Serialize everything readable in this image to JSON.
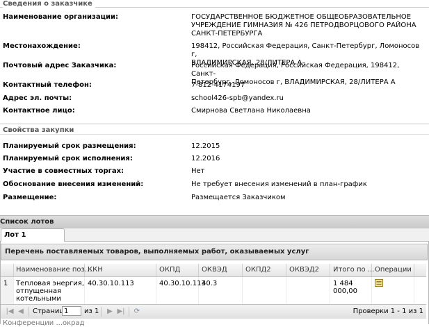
{
  "customer": {
    "legend": "Сведения о заказчике",
    "fields": [
      {
        "label": "Наименование организации:",
        "value": "ГОСУДАРСТВЕННОЕ БЮДЖЕТНОЕ ОБЩЕОБРАЗОВАТЕЛЬНОЕ\nУЧРЕЖДЕНИЕ ГИМНАЗИЯ № 426 ПЕТРОДВОРЦОВОГО РАЙОНА\nСАНКТ-ПЕТЕРБУРГА"
      },
      {
        "label": "Местонахождение:",
        "value": "198412, Российская Федерация, Санкт-Петербург, Ломоносов г,\nВЛАДИМИРСКАЯ, 28/ЛИТЕРА А"
      },
      {
        "label": "Почтовый адрес Заказчика:",
        "value": "Российская Федерация, Российская Федерация, 198412, Санкт-\nПетербург, Ломоносов г, ВЛАДИМИРСКАЯ, 28/ЛИТЕРА А"
      },
      {
        "label": "Контактный телефон:",
        "value": "7-812-4174197"
      },
      {
        "label": "Адрес эл. почты:",
        "value": "school426-spb@yandex.ru"
      },
      {
        "label": "Контактное лицо:",
        "value": "Смирнова Светлана Николаевна"
      }
    ]
  },
  "purchase": {
    "legend": "Свойства закупки",
    "fields": [
      {
        "label": "Планируемый срок размещения:",
        "value": "12.2015"
      },
      {
        "label": "Планируемый срок исполнения:",
        "value": "12.2016"
      },
      {
        "label": "Участие в совместных торгах:",
        "value": "Нет"
      },
      {
        "label": "Обоснование внесения изменений:",
        "value": "Не требует внесения изменений в план-график"
      },
      {
        "label": "Размещение:",
        "value": "Размещается Заказчиком"
      }
    ]
  },
  "lots": {
    "panel_title": "Список лотов",
    "tab_label": "Лот 1",
    "subheader": "Перечень поставляемых товаров, выполняемых работ, оказываемых услуг",
    "columns": [
      "Наименование поз...",
      "ККН",
      "ОКПД",
      "ОКВЭД",
      "ОКПД2",
      "ОКВЭД2",
      "Итого по ...",
      "Операции"
    ],
    "rows": [
      {
        "num": "1",
        "name": "Тепловая энергия,\nотпущенная\nкотельными",
        "kkn": "40.30.10.113",
        "okpd": "40.30.10.113",
        "okved": "40.3",
        "okpd2": "",
        "okved2": "",
        "total": "1 484\n000,00",
        "op_icon": "document-icon"
      }
    ],
    "pager": {
      "page_label": "Страница",
      "page_value": "1",
      "of_label": "из 1",
      "summary": "Проверки 1 - 1 из 1"
    }
  },
  "footer_cut": "Конференции ...окрад"
}
